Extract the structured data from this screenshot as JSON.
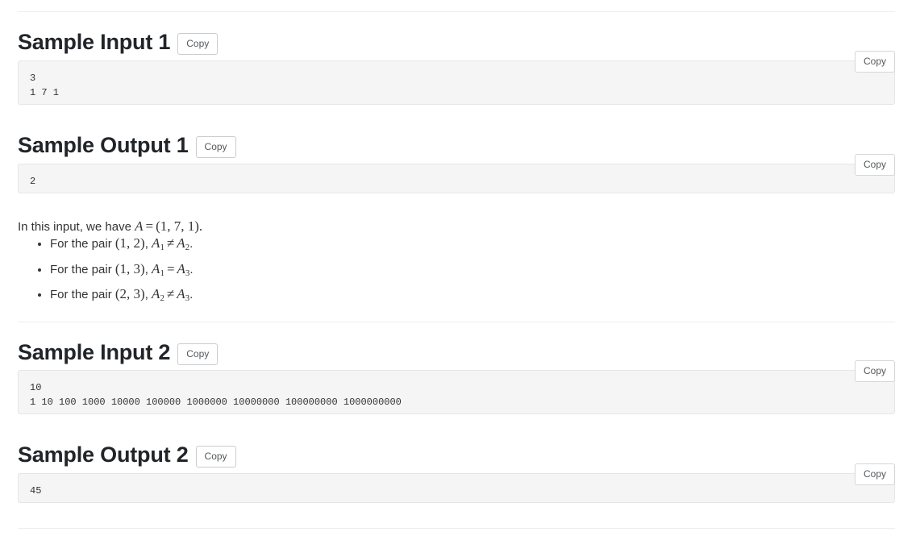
{
  "sections": [
    {
      "id": "sample-input-1",
      "title": "Sample Input 1",
      "heading_copy_label": "Copy",
      "block_copy_label": "Copy",
      "code": "3\n1 7 1"
    },
    {
      "id": "sample-output-1",
      "title": "Sample Output 1",
      "heading_copy_label": "Copy",
      "block_copy_label": "Copy",
      "code": "2"
    },
    {
      "id": "sample-input-2",
      "title": "Sample Input 2",
      "heading_copy_label": "Copy",
      "block_copy_label": "Copy",
      "code": "10\n1 10 100 1000 10000 100000 1000000 10000000 100000000 1000000000"
    },
    {
      "id": "sample-output-2",
      "title": "Sample Output 2",
      "heading_copy_label": "Copy",
      "block_copy_label": "Copy",
      "code": "45"
    }
  ],
  "explanation": {
    "intro_text": "In this input, we have ",
    "intro_math": {
      "variable": "A",
      "operator": "=",
      "tuple": "(1, 7, 1)",
      "period": "."
    },
    "bullets": [
      {
        "lead": "For the pair ",
        "pair": "(1, 2)",
        "comma": ", ",
        "left_var": "A",
        "left_sub": "1",
        "relation": "≠",
        "right_var": "A",
        "right_sub": "2",
        "period": "."
      },
      {
        "lead": "For the pair ",
        "pair": "(1, 3)",
        "comma": ", ",
        "left_var": "A",
        "left_sub": "1",
        "relation": "=",
        "right_var": "A",
        "right_sub": "3",
        "period": "."
      },
      {
        "lead": "For the pair ",
        "pair": "(2, 3)",
        "comma": ", ",
        "left_var": "A",
        "left_sub": "2",
        "relation": "≠",
        "right_var": "A",
        "right_sub": "3",
        "period": "."
      }
    ]
  },
  "colors": {
    "page_background": "#ffffff",
    "code_background": "#f5f5f5",
    "code_border": "#e6e6e6",
    "divider": "#eceeef",
    "heading_text": "#212529",
    "body_text": "#333333",
    "button_text": "#55595c",
    "button_border": "#cccccc"
  }
}
